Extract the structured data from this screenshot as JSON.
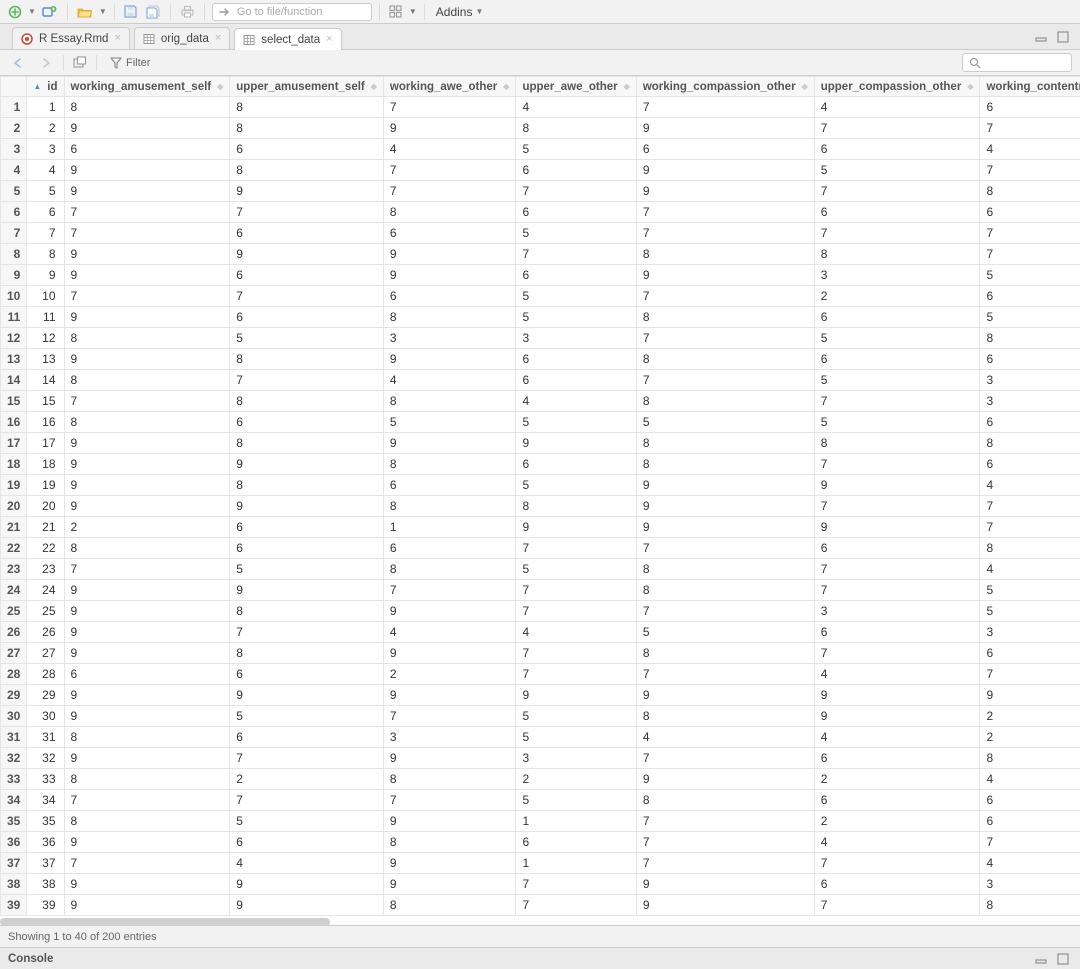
{
  "toolbar": {
    "goto_placeholder": "Go to file/function",
    "addins_label": "Addins"
  },
  "tabs": [
    {
      "label": "R Essay.Rmd",
      "icon": "rmd",
      "active": false
    },
    {
      "label": "orig_data",
      "icon": "table",
      "active": false
    },
    {
      "label": "select_data",
      "icon": "table",
      "active": true
    }
  ],
  "viewer": {
    "filter_label": "Filter",
    "search_placeholder": ""
  },
  "table": {
    "columns": [
      "id",
      "working_amusement_self",
      "upper_amusement_self",
      "working_awe_other",
      "upper_awe_other",
      "working_compassion_other",
      "upper_compassion_other",
      "working_contentment_self"
    ],
    "sorted_column": "id",
    "rows": [
      {
        "n": 1,
        "id": 1,
        "v": [
          8,
          8,
          7,
          4,
          7,
          4,
          6
        ]
      },
      {
        "n": 2,
        "id": 2,
        "v": [
          9,
          8,
          9,
          8,
          9,
          7,
          7
        ]
      },
      {
        "n": 3,
        "id": 3,
        "v": [
          6,
          6,
          4,
          5,
          6,
          6,
          4
        ]
      },
      {
        "n": 4,
        "id": 4,
        "v": [
          9,
          8,
          7,
          6,
          9,
          5,
          7
        ]
      },
      {
        "n": 5,
        "id": 5,
        "v": [
          9,
          9,
          7,
          7,
          9,
          7,
          8
        ]
      },
      {
        "n": 6,
        "id": 6,
        "v": [
          7,
          7,
          8,
          6,
          7,
          6,
          6
        ]
      },
      {
        "n": 7,
        "id": 7,
        "v": [
          7,
          6,
          6,
          5,
          7,
          7,
          7
        ]
      },
      {
        "n": 8,
        "id": 8,
        "v": [
          9,
          9,
          9,
          7,
          8,
          8,
          7
        ]
      },
      {
        "n": 9,
        "id": 9,
        "v": [
          9,
          6,
          9,
          6,
          9,
          3,
          5
        ]
      },
      {
        "n": 10,
        "id": 10,
        "v": [
          7,
          7,
          6,
          5,
          7,
          2,
          6
        ]
      },
      {
        "n": 11,
        "id": 11,
        "v": [
          9,
          6,
          8,
          5,
          8,
          6,
          5
        ]
      },
      {
        "n": 12,
        "id": 12,
        "v": [
          8,
          5,
          3,
          3,
          7,
          5,
          8
        ]
      },
      {
        "n": 13,
        "id": 13,
        "v": [
          9,
          8,
          9,
          6,
          8,
          6,
          6
        ]
      },
      {
        "n": 14,
        "id": 14,
        "v": [
          8,
          7,
          4,
          6,
          7,
          5,
          3
        ]
      },
      {
        "n": 15,
        "id": 15,
        "v": [
          7,
          8,
          8,
          4,
          8,
          7,
          3
        ]
      },
      {
        "n": 16,
        "id": 16,
        "v": [
          8,
          6,
          5,
          5,
          5,
          5,
          6
        ]
      },
      {
        "n": 17,
        "id": 17,
        "v": [
          9,
          8,
          9,
          9,
          8,
          8,
          8
        ]
      },
      {
        "n": 18,
        "id": 18,
        "v": [
          9,
          9,
          8,
          6,
          8,
          7,
          6
        ]
      },
      {
        "n": 19,
        "id": 19,
        "v": [
          9,
          8,
          6,
          5,
          9,
          9,
          4
        ]
      },
      {
        "n": 20,
        "id": 20,
        "v": [
          9,
          9,
          8,
          8,
          9,
          7,
          7
        ]
      },
      {
        "n": 21,
        "id": 21,
        "v": [
          2,
          6,
          1,
          9,
          9,
          9,
          7
        ]
      },
      {
        "n": 22,
        "id": 22,
        "v": [
          8,
          6,
          6,
          7,
          7,
          6,
          8
        ]
      },
      {
        "n": 23,
        "id": 23,
        "v": [
          7,
          5,
          8,
          5,
          8,
          7,
          4
        ]
      },
      {
        "n": 24,
        "id": 24,
        "v": [
          9,
          9,
          7,
          7,
          8,
          7,
          5
        ]
      },
      {
        "n": 25,
        "id": 25,
        "v": [
          9,
          8,
          9,
          7,
          7,
          3,
          5
        ]
      },
      {
        "n": 26,
        "id": 26,
        "v": [
          9,
          7,
          4,
          4,
          5,
          6,
          3
        ]
      },
      {
        "n": 27,
        "id": 27,
        "v": [
          9,
          8,
          9,
          7,
          8,
          7,
          6
        ]
      },
      {
        "n": 28,
        "id": 28,
        "v": [
          6,
          6,
          2,
          7,
          7,
          4,
          7
        ]
      },
      {
        "n": 29,
        "id": 29,
        "v": [
          9,
          9,
          9,
          9,
          9,
          9,
          9
        ]
      },
      {
        "n": 30,
        "id": 30,
        "v": [
          9,
          5,
          7,
          5,
          8,
          9,
          2
        ]
      },
      {
        "n": 31,
        "id": 31,
        "v": [
          8,
          6,
          3,
          5,
          4,
          4,
          2
        ]
      },
      {
        "n": 32,
        "id": 32,
        "v": [
          9,
          7,
          9,
          3,
          7,
          6,
          8
        ]
      },
      {
        "n": 33,
        "id": 33,
        "v": [
          8,
          2,
          8,
          2,
          9,
          2,
          4
        ]
      },
      {
        "n": 34,
        "id": 34,
        "v": [
          7,
          7,
          7,
          5,
          8,
          6,
          6
        ]
      },
      {
        "n": 35,
        "id": 35,
        "v": [
          8,
          5,
          9,
          1,
          7,
          2,
          6
        ]
      },
      {
        "n": 36,
        "id": 36,
        "v": [
          9,
          6,
          8,
          6,
          7,
          4,
          7
        ]
      },
      {
        "n": 37,
        "id": 37,
        "v": [
          7,
          4,
          9,
          1,
          7,
          7,
          4
        ]
      },
      {
        "n": 38,
        "id": 38,
        "v": [
          9,
          9,
          9,
          7,
          9,
          6,
          3
        ]
      },
      {
        "n": 39,
        "id": 39,
        "v": [
          9,
          9,
          8,
          7,
          9,
          7,
          8
        ]
      }
    ],
    "footer": "Showing 1 to 40 of 200 entries"
  },
  "console": {
    "label": "Console"
  }
}
